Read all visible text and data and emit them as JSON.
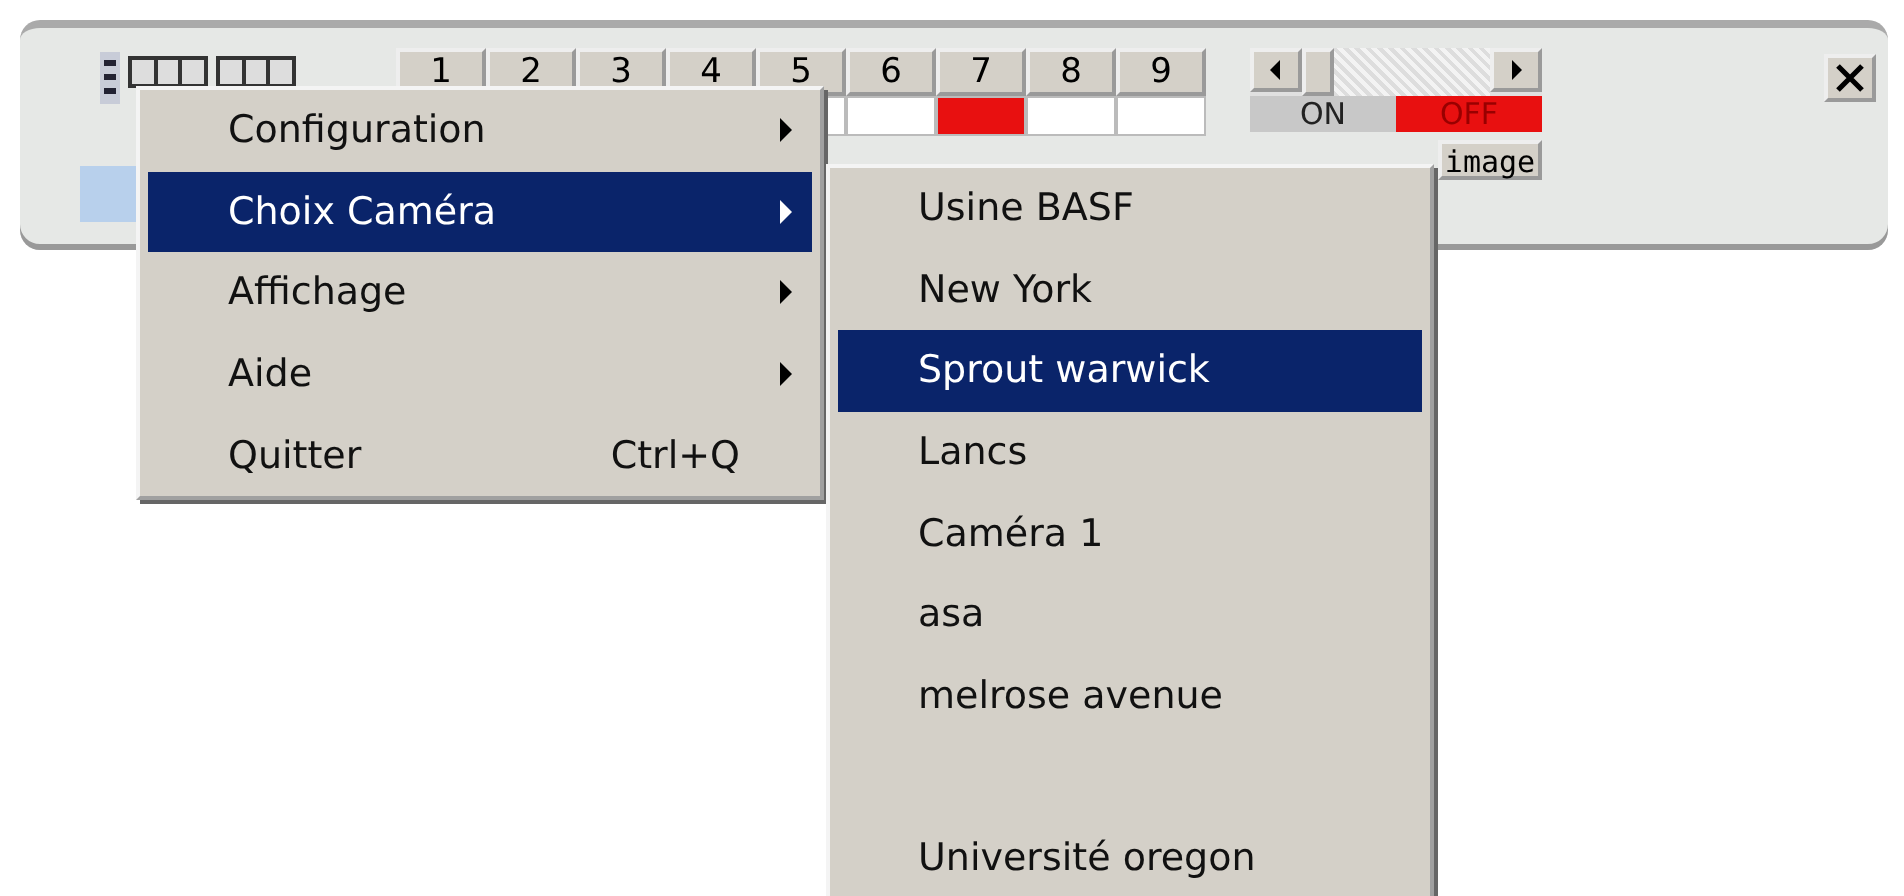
{
  "toolbar": {
    "channels": [
      {
        "label": "1"
      },
      {
        "label": "2"
      },
      {
        "label": "3"
      },
      {
        "label": "4"
      },
      {
        "label": "5",
        "active": false
      },
      {
        "label": "6",
        "active": false
      },
      {
        "label": "7",
        "active": true
      },
      {
        "label": "8",
        "active": false
      },
      {
        "label": "9",
        "active": false
      }
    ],
    "on_label": "ON",
    "off_label": "OFF",
    "on": false,
    "image_button": "image"
  },
  "menu": {
    "items": [
      {
        "label": "Configuration",
        "submenu": true,
        "selected": false
      },
      {
        "label": "Choix Caméra",
        "submenu": true,
        "selected": true
      },
      {
        "label": "Affichage",
        "submenu": true,
        "selected": false
      },
      {
        "label": "Aide",
        "submenu": true,
        "selected": false
      },
      {
        "label": "Quitter",
        "shortcut": "Ctrl+Q",
        "submenu": false,
        "selected": false
      }
    ]
  },
  "submenu": {
    "items": [
      {
        "kind": "item",
        "label": "Usine BASF",
        "selected": false
      },
      {
        "kind": "item",
        "label": "New York",
        "selected": false
      },
      {
        "kind": "item",
        "label": "Sprout warwick",
        "selected": true
      },
      {
        "kind": "item",
        "label": "Lancs",
        "selected": false
      },
      {
        "kind": "item",
        "label": "Caméra 1",
        "selected": false
      },
      {
        "kind": "item",
        "label": "asa",
        "selected": false
      },
      {
        "kind": "item",
        "label": "melrose avenue",
        "selected": false
      },
      {
        "kind": "blank"
      },
      {
        "kind": "item",
        "label": "Université oregon",
        "selected": false
      }
    ]
  }
}
